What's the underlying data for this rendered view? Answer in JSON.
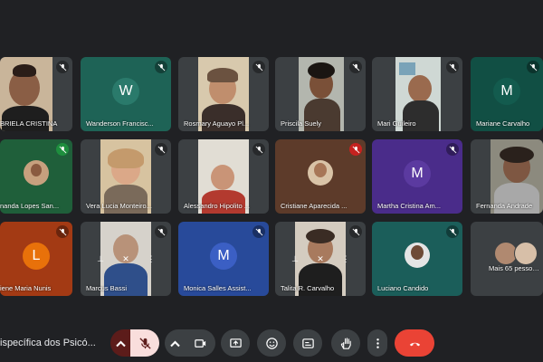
{
  "meeting": {
    "title": "ispecífica dos Psicó..."
  },
  "participants": [
    {
      "name": "BRIELA CRISTINA"
    },
    {
      "name": "Wanderson Francisc..."
    },
    {
      "name": "Rosmary Aguayo Pl..."
    },
    {
      "name": "Priscila Suely"
    },
    {
      "name": "Mari Guileiro"
    },
    {
      "name": "Mariane Carvalho"
    },
    {
      "name": "nanda Lopes San..."
    },
    {
      "name": "Vera Lucia Monteiro..."
    },
    {
      "name": "Alessandro Hipolito ..."
    },
    {
      "name": "Cristiane Aparecida ..."
    },
    {
      "name": "Martha Cristina Am..."
    },
    {
      "name": "Fernanda Andrade"
    },
    {
      "name": "iene Maria Nunis"
    },
    {
      "name": "Marcus Bassi"
    },
    {
      "name": "Monica Salles Assist..."
    },
    {
      "name": "Talita R. Carvalho"
    },
    {
      "name": "Luciano Candido"
    },
    {
      "name": "Mais 65 pessoas"
    }
  ],
  "avatars": {
    "wanderson": "W",
    "mariane": "M",
    "martha": "M",
    "iene": "L",
    "monica": "M"
  },
  "colors": {
    "background": "#202124",
    "end_call": "#ea4335",
    "mic_off": "#f9dedc",
    "tile_gray": "#3c4043"
  }
}
